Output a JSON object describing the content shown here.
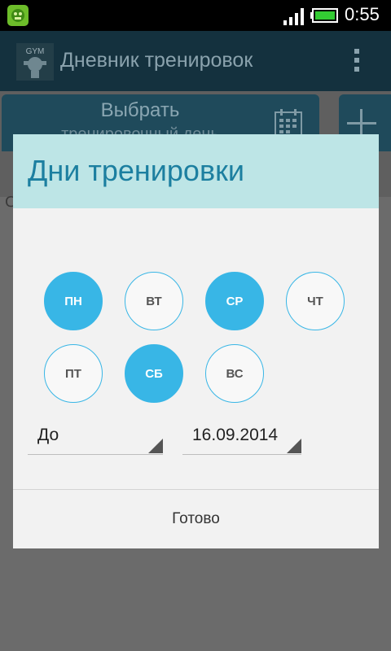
{
  "status_bar": {
    "time": "0:55",
    "notification_icon": "app-notification-icon",
    "signal_icon": "signal-bars-icon",
    "battery_icon": "battery-charging-icon"
  },
  "action_bar": {
    "title": "Дневник тренировок",
    "logo_text": "GYM",
    "menu_icon": "overflow-menu-icon"
  },
  "background": {
    "select_button_label": "Выбрать",
    "select_button_sublabel": "тренировочный день",
    "calendar_icon": "calendar-icon",
    "add_icon": "plus-icon",
    "content_fragment": "С"
  },
  "dialog": {
    "title": "Дни тренировки",
    "days": [
      {
        "label": "ПН",
        "selected": true
      },
      {
        "label": "ВТ",
        "selected": false
      },
      {
        "label": "СР",
        "selected": true
      },
      {
        "label": "ЧТ",
        "selected": false
      },
      {
        "label": "ПТ",
        "selected": false
      },
      {
        "label": "СБ",
        "selected": true
      },
      {
        "label": "ВС",
        "selected": false
      }
    ],
    "until_spinner": "До",
    "date_spinner": "16.09.2014",
    "done_button": "Готово"
  },
  "colors": {
    "accent": "#38b6e6",
    "header_bg": "#bde5e6",
    "title_color": "#1c7fa0",
    "dialog_bg": "#f2f2f2"
  }
}
